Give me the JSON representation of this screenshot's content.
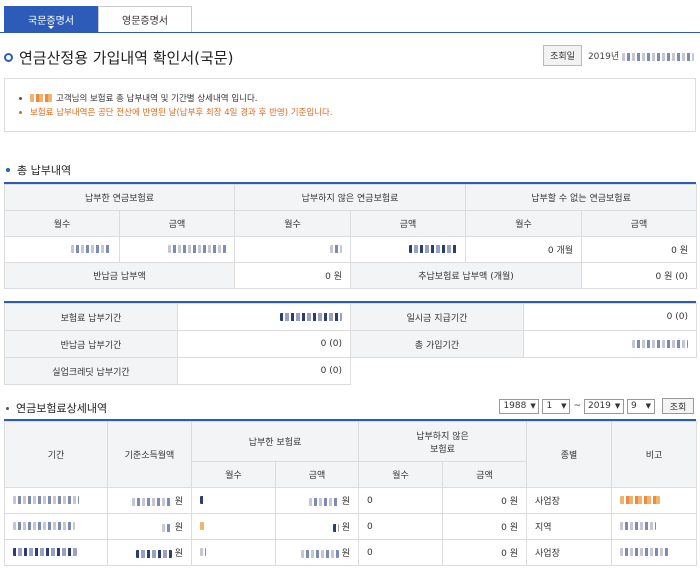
{
  "tabs": [
    {
      "label": "국문증명서",
      "active": true
    },
    {
      "label": "영문증명서",
      "active": false
    }
  ],
  "title": "연금산정용 가입내역 확인서(국문)",
  "inquiry": {
    "label": "조회일",
    "date_prefix": "2019년"
  },
  "notice": {
    "line1": "고객님의 보험료 총 납부내역 및 기간별 상세내역 입니다.",
    "line2": "보험료 납부내역은 공단 전산에 반영된 날(납부후 최장 4일 경과 후 반영) 기준입니다."
  },
  "summary": {
    "heading": "총 납부내역",
    "groups": [
      "납부한 연금보험료",
      "납부하지 않은 연금보험료",
      "납부할 수 없는 연금보험료"
    ],
    "sub": [
      "월수",
      "금액",
      "월수",
      "금액",
      "월수",
      "금액"
    ],
    "row": {
      "unpayable_months": "0 개월",
      "unpayable_amount": "0 원"
    },
    "refund_label": "반납금 납부액",
    "refund_value": "0 원",
    "extra_label": "추납보험료 납부액 (개월)",
    "extra_value": "0 원 (0)"
  },
  "periods": {
    "premium_label": "보험료 납부기간",
    "lump_label": "일시금 지급기간",
    "lump_value": "0 (0)",
    "refund_label": "반납금 납부기간",
    "refund_value": "0 (0)",
    "total_label": "총 가입기간",
    "unemp_label": "실업크레딧 납부기간",
    "unemp_value": "0 (0)"
  },
  "detail": {
    "heading": "연금보험료상세내역",
    "filter": {
      "from_year": "1988",
      "from_month": "1",
      "tilde": "~",
      "to_year": "2019",
      "to_month": "9",
      "button": "조회"
    },
    "headers": {
      "period": "기간",
      "income": "기준소득월액",
      "paid": "납부한 보험료",
      "unpaid_l1": "납부하지 않은",
      "unpaid_l2": "보험료",
      "type": "종별",
      "note": "비고",
      "months": "월수",
      "amount": "금액"
    },
    "rows": [
      {
        "income_unit": "원",
        "paid_unit": "원",
        "unpaid_months": "0",
        "unpaid_amount": "0 원",
        "type": "사업장"
      },
      {
        "income_unit": "원",
        "paid_unit": "원",
        "unpaid_months": "0",
        "unpaid_amount": "0 원",
        "type": "지역"
      },
      {
        "income_unit": "원",
        "paid_unit": "원",
        "unpaid_months": "0",
        "unpaid_amount": "0 원",
        "type": "사업장"
      }
    ]
  },
  "colors": {
    "accent": "#2d5cb8",
    "notice_orange": "#e06a1a"
  }
}
